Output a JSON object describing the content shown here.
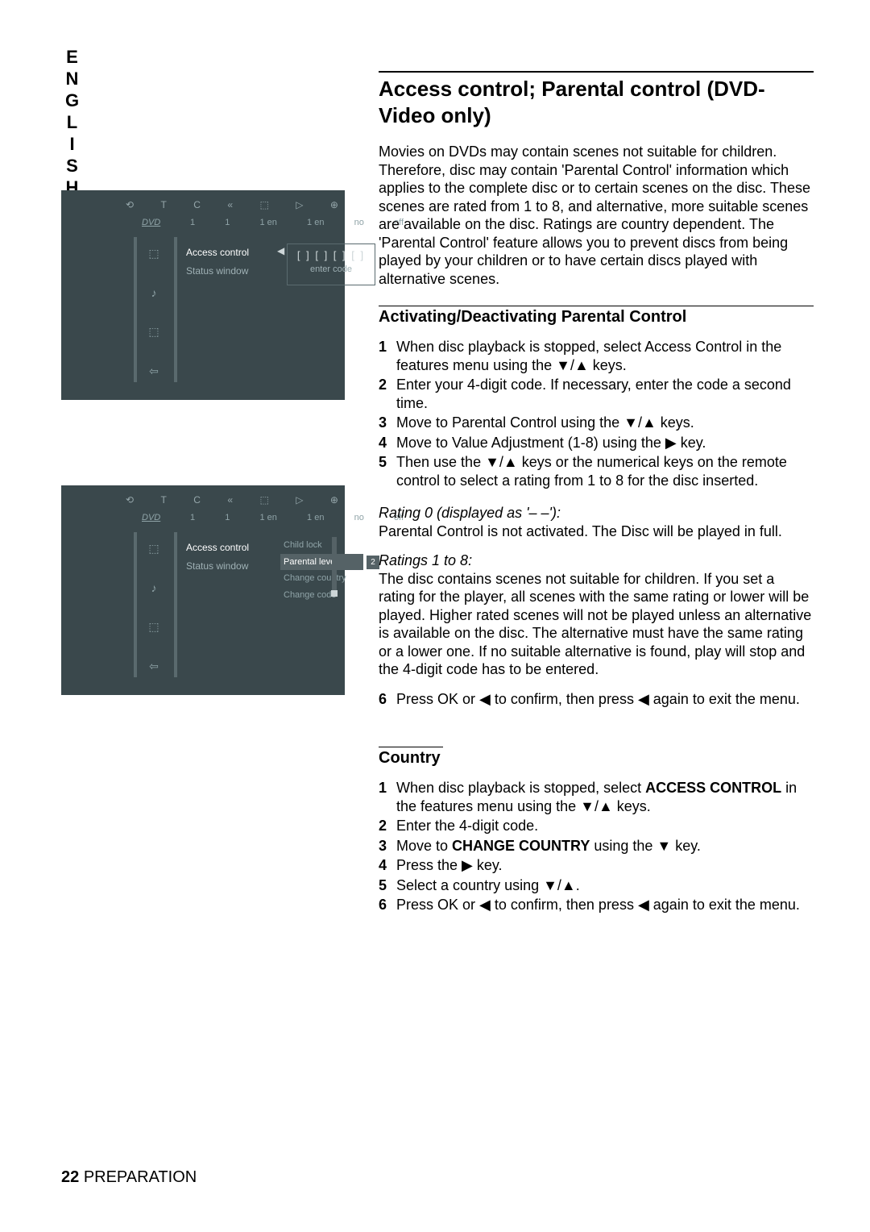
{
  "language_tab": "ENGLISH",
  "heading": "Access control; Parental control (DVD-Video only)",
  "intro": "Movies on DVDs may contain scenes not suitable for children. Therefore, disc may contain 'Parental Control' information which applies to the complete disc or to certain scenes on the disc. These scenes are rated from 1 to 8, and alternative, more suitable scenes are available on the disc. Ratings are country dependent. The 'Parental Control' feature allows you to prevent discs from being played by your children or to have certain discs played with alternative scenes.",
  "sub1_title": "Activating/Deactivating Parental Control",
  "steps_a": [
    "When disc playback is stopped, select Access Control in the features menu using the ▼/▲ keys.",
    "Enter your 4-digit code. If necessary, enter the code a second time.",
    "Move to Parental Control using the ▼/▲ keys.",
    "Move to Value Adjustment (1-8) using the ▶ key.",
    "Then use the ▼/▲ keys or the numerical keys on the remote control to select a rating from 1 to 8 for the disc inserted."
  ],
  "rating0_label": "Rating 0 (displayed as '– –'):",
  "rating0_text": "Parental Control is not activated. The Disc will be played in full.",
  "rating1_label": "Ratings 1 to 8:",
  "rating1_text": "The disc contains scenes not suitable for children. If you set a rating for the player, all scenes with the same rating or lower will be played. Higher rated scenes will not be played unless an alternative is available on the disc. The alternative must have the same rating or a lower one. If no suitable alternative is found, play will stop and the 4-digit code has to be entered.",
  "step6_a": "Press OK or ◀ to confirm, then press ◀ again to exit the menu.",
  "sub2_title": "Country",
  "steps_b": [
    "When disc playback is stopped, select <b>ACCESS CONTROL</b> in the features menu using the ▼/▲ keys.",
    "Enter the 4-digit code.",
    "Move to <b>CHANGE COUNTRY</b> using the ▼ key.",
    "Press the ▶ key.",
    "Select a country using ▼/▲.",
    "Press OK or ◀ to confirm, then press ◀ again to exit the menu."
  ],
  "footer_page": "22",
  "footer_section": "PREPARATION",
  "osd": {
    "top_icons": [
      "⟲",
      "T",
      "C",
      "«",
      "⬚",
      "▷",
      "⊕"
    ],
    "dvd_label": "DVD",
    "row2": [
      "1",
      "1",
      "1 en",
      "1 en",
      "no",
      "off"
    ],
    "menu": [
      "Access control",
      "Status window"
    ],
    "codebox_brackets": "[ ] [ ] [ ] [ ]",
    "codebox_label": "enter code",
    "submenu": [
      {
        "label": "Child lock",
        "val": ""
      },
      {
        "label": "Parental level",
        "val": "2",
        "hl": true
      },
      {
        "label": "Change country",
        "val": ""
      },
      {
        "label": "Change code",
        "val": ""
      }
    ],
    "side_icons": [
      "⬚",
      "♪",
      "⬚",
      "⇦"
    ]
  }
}
